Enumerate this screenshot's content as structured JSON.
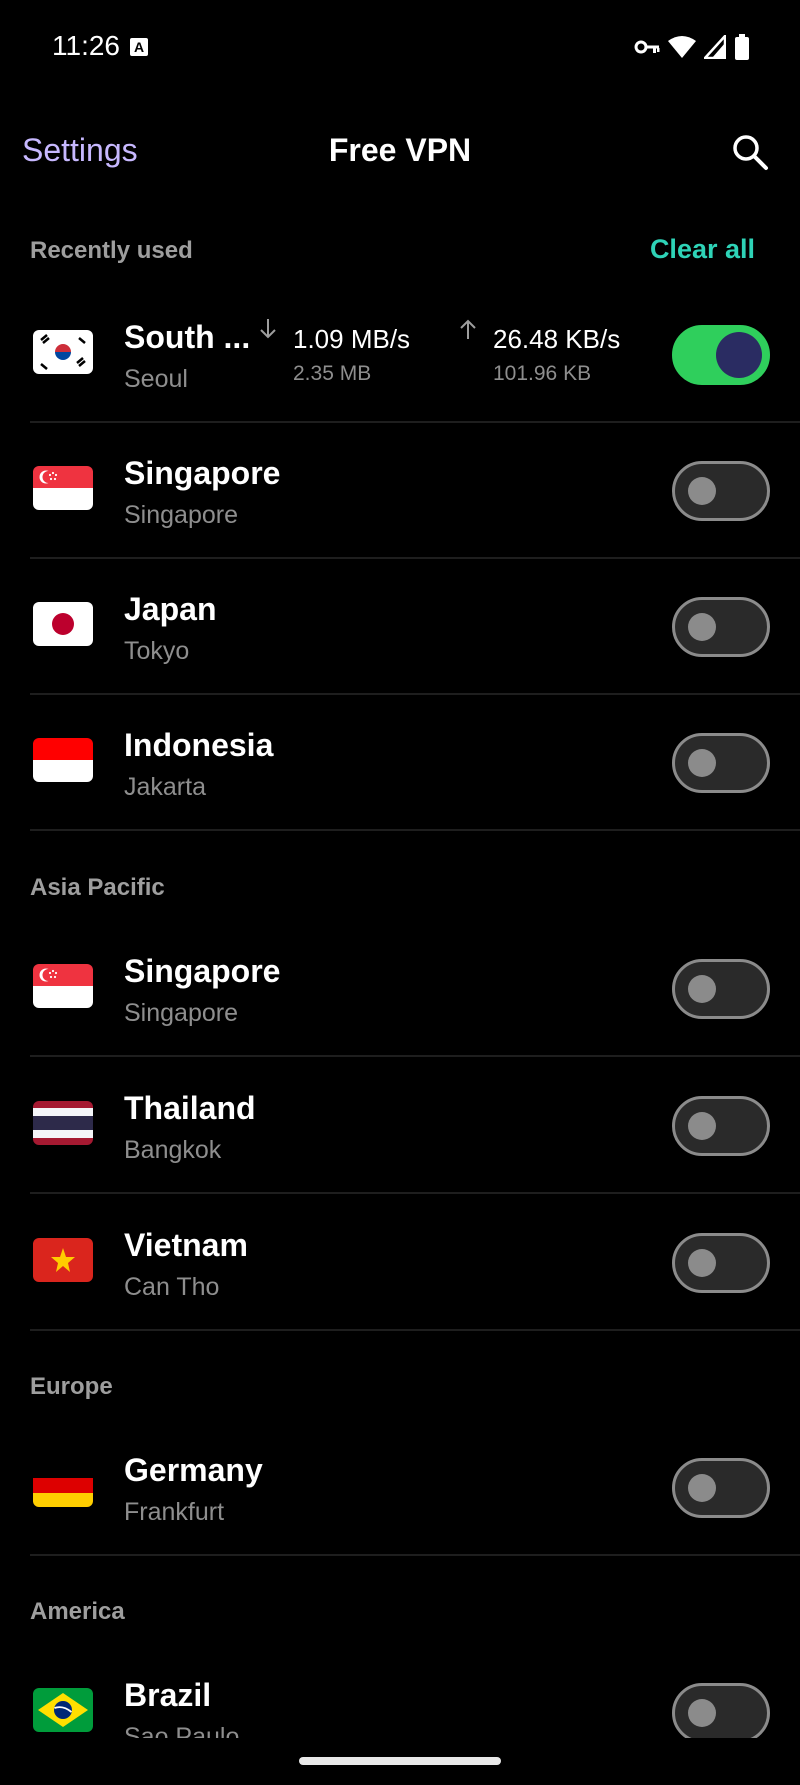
{
  "status_bar": {
    "time": "11:26",
    "a_label": "A"
  },
  "header": {
    "back_label": "Settings",
    "title": "Free VPN"
  },
  "recent": {
    "label": "Recently used",
    "clear_all": "Clear all",
    "items": [
      {
        "country": "South ...",
        "city": "Seoul",
        "connected": true,
        "download_speed": "1.09 MB/s",
        "download_total": "2.35 MB",
        "upload_speed": "26.48 KB/s",
        "upload_total": "101.96 KB"
      },
      {
        "country": "Singapore",
        "city": "Singapore",
        "connected": false
      },
      {
        "country": "Japan",
        "city": "Tokyo",
        "connected": false
      },
      {
        "country": "Indonesia",
        "city": "Jakarta",
        "connected": false
      }
    ]
  },
  "asia": {
    "label": "Asia Pacific",
    "items": [
      {
        "country": "Singapore",
        "city": "Singapore",
        "connected": false
      },
      {
        "country": "Thailand",
        "city": "Bangkok",
        "connected": false
      },
      {
        "country": "Vietnam",
        "city": "Can Tho",
        "connected": false
      }
    ]
  },
  "europe": {
    "label": "Europe",
    "items": [
      {
        "country": "Germany",
        "city": "Frankfurt",
        "connected": false
      }
    ]
  },
  "america": {
    "label": "America",
    "items": [
      {
        "country": "Brazil",
        "city": "Sao Paulo",
        "connected": false
      }
    ]
  },
  "colors": {
    "accent_purple": "#c7b8ff",
    "accent_teal": "#2ed3b7",
    "toggle_on": "#2fcf5c"
  }
}
